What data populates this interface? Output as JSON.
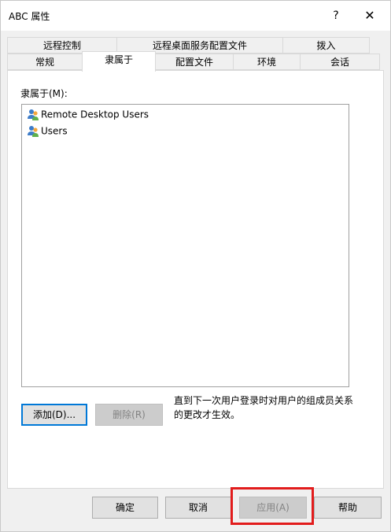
{
  "window": {
    "title": "ABC 属性",
    "help_glyph": "?",
    "close_glyph": "✕"
  },
  "tabs_back": [
    "远程控制",
    "远程桌面服务配置文件",
    "拨入"
  ],
  "tabs_front": [
    "常规",
    "隶属于",
    "配置文件",
    "环境",
    "会话"
  ],
  "active_tab": "隶属于",
  "panel": {
    "list_label": "隶属于(M):",
    "groups": [
      "Remote Desktop Users",
      "Users"
    ],
    "add_button": "添加(D)...",
    "remove_button": "删除(R)",
    "note": "直到下一次用户登录时对用户的组成员关系的更改才生效。"
  },
  "footer": {
    "ok": "确定",
    "cancel": "取消",
    "apply": "应用(A)",
    "help": "帮助"
  },
  "colors": {
    "highlight": "#e21c1c",
    "default_border": "#0078d7"
  },
  "icons": {
    "group": "group-users-icon"
  }
}
